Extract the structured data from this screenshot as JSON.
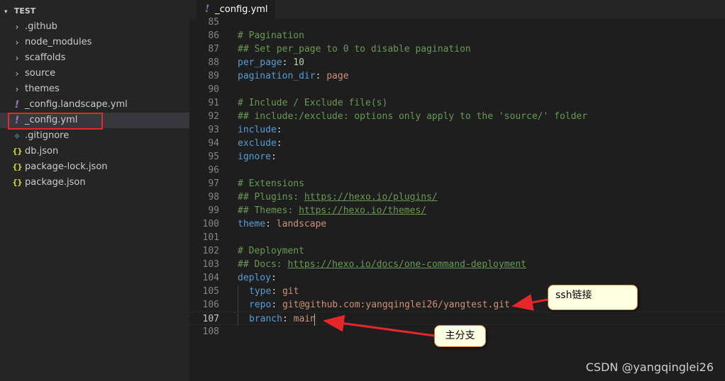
{
  "explorer": {
    "folder_name": "TEST",
    "items": [
      {
        "label": ".github",
        "icon": "chevron-right-icon",
        "kind": "folder"
      },
      {
        "label": "node_modules",
        "icon": "chevron-right-icon",
        "kind": "folder"
      },
      {
        "label": "scaffolds",
        "icon": "chevron-right-icon",
        "kind": "folder"
      },
      {
        "label": "source",
        "icon": "chevron-right-icon",
        "kind": "folder"
      },
      {
        "label": "themes",
        "icon": "chevron-right-icon",
        "kind": "folder"
      },
      {
        "label": "_config.landscape.yml",
        "icon": "yaml-icon",
        "kind": "file"
      },
      {
        "label": "_config.yml",
        "icon": "yaml-icon",
        "kind": "file",
        "selected": true
      },
      {
        "label": ".gitignore",
        "icon": "git-icon",
        "kind": "file"
      },
      {
        "label": "db.json",
        "icon": "json-icon",
        "kind": "file"
      },
      {
        "label": "package-lock.json",
        "icon": "json-icon",
        "kind": "file"
      },
      {
        "label": "package.json",
        "icon": "json-icon",
        "kind": "file"
      }
    ]
  },
  "tab": {
    "label": "_config.yml",
    "icon": "yaml-icon"
  },
  "editor": {
    "active_line": 107,
    "lines": [
      {
        "n": "85",
        "tokens": []
      },
      {
        "n": "86",
        "tokens": [
          {
            "t": "# Pagination",
            "c": "cmt"
          }
        ]
      },
      {
        "n": "87",
        "tokens": [
          {
            "t": "## Set per_page to 0 to disable pagination",
            "c": "cmt"
          }
        ]
      },
      {
        "n": "88",
        "tokens": [
          {
            "t": "per_page",
            "c": "key"
          },
          {
            "t": ": ",
            "c": ""
          },
          {
            "t": "10",
            "c": "num"
          }
        ]
      },
      {
        "n": "89",
        "tokens": [
          {
            "t": "pagination_dir",
            "c": "key"
          },
          {
            "t": ": ",
            "c": ""
          },
          {
            "t": "page",
            "c": "str"
          }
        ]
      },
      {
        "n": "90",
        "tokens": []
      },
      {
        "n": "91",
        "tokens": [
          {
            "t": "# Include / Exclude file(s)",
            "c": "cmt"
          }
        ]
      },
      {
        "n": "92",
        "tokens": [
          {
            "t": "## include:/exclude: options only apply to the 'source/' folder",
            "c": "cmt"
          }
        ]
      },
      {
        "n": "93",
        "tokens": [
          {
            "t": "include",
            "c": "key"
          },
          {
            "t": ":",
            "c": ""
          }
        ]
      },
      {
        "n": "94",
        "tokens": [
          {
            "t": "exclude",
            "c": "key"
          },
          {
            "t": ":",
            "c": ""
          }
        ]
      },
      {
        "n": "95",
        "tokens": [
          {
            "t": "ignore",
            "c": "key"
          },
          {
            "t": ":",
            "c": ""
          }
        ]
      },
      {
        "n": "96",
        "tokens": []
      },
      {
        "n": "97",
        "tokens": [
          {
            "t": "# Extensions",
            "c": "cmt"
          }
        ]
      },
      {
        "n": "98",
        "tokens": [
          {
            "t": "## Plugins: ",
            "c": "cmt"
          },
          {
            "t": "https://hexo.io/plugins/",
            "c": "url"
          }
        ]
      },
      {
        "n": "99",
        "tokens": [
          {
            "t": "## Themes: ",
            "c": "cmt"
          },
          {
            "t": "https://hexo.io/themes/",
            "c": "url"
          }
        ]
      },
      {
        "n": "100",
        "tokens": [
          {
            "t": "theme",
            "c": "key"
          },
          {
            "t": ": ",
            "c": ""
          },
          {
            "t": "landscape",
            "c": "str"
          }
        ]
      },
      {
        "n": "101",
        "tokens": []
      },
      {
        "n": "102",
        "tokens": [
          {
            "t": "# Deployment",
            "c": "cmt"
          }
        ]
      },
      {
        "n": "103",
        "tokens": [
          {
            "t": "## Docs: ",
            "c": "cmt"
          },
          {
            "t": "https://hexo.io/docs/one-command-deployment",
            "c": "url"
          }
        ]
      },
      {
        "n": "104",
        "tokens": [
          {
            "t": "deploy",
            "c": "key"
          },
          {
            "t": ":",
            "c": ""
          }
        ]
      },
      {
        "n": "105",
        "indent": true,
        "tokens": [
          {
            "t": "type",
            "c": "key"
          },
          {
            "t": ": ",
            "c": ""
          },
          {
            "t": "git",
            "c": "str"
          }
        ]
      },
      {
        "n": "106",
        "indent": true,
        "tokens": [
          {
            "t": "repo",
            "c": "key"
          },
          {
            "t": ": ",
            "c": ""
          },
          {
            "t": "git@github.com:yangqinglei26/yangtest.git",
            "c": "str"
          }
        ]
      },
      {
        "n": "107",
        "indent": true,
        "tokens": [
          {
            "t": "branch",
            "c": "key"
          },
          {
            "t": ": ",
            "c": ""
          },
          {
            "t": "main",
            "c": "str"
          }
        ]
      },
      {
        "n": "108",
        "tokens": []
      }
    ]
  },
  "annotations": {
    "ssh_label": "ssh链接",
    "branch_label": "主分支",
    "arrow_color": "#e5262b",
    "highlight_color": "#e5262b"
  },
  "watermark": "CSDN @yangqinglei26"
}
